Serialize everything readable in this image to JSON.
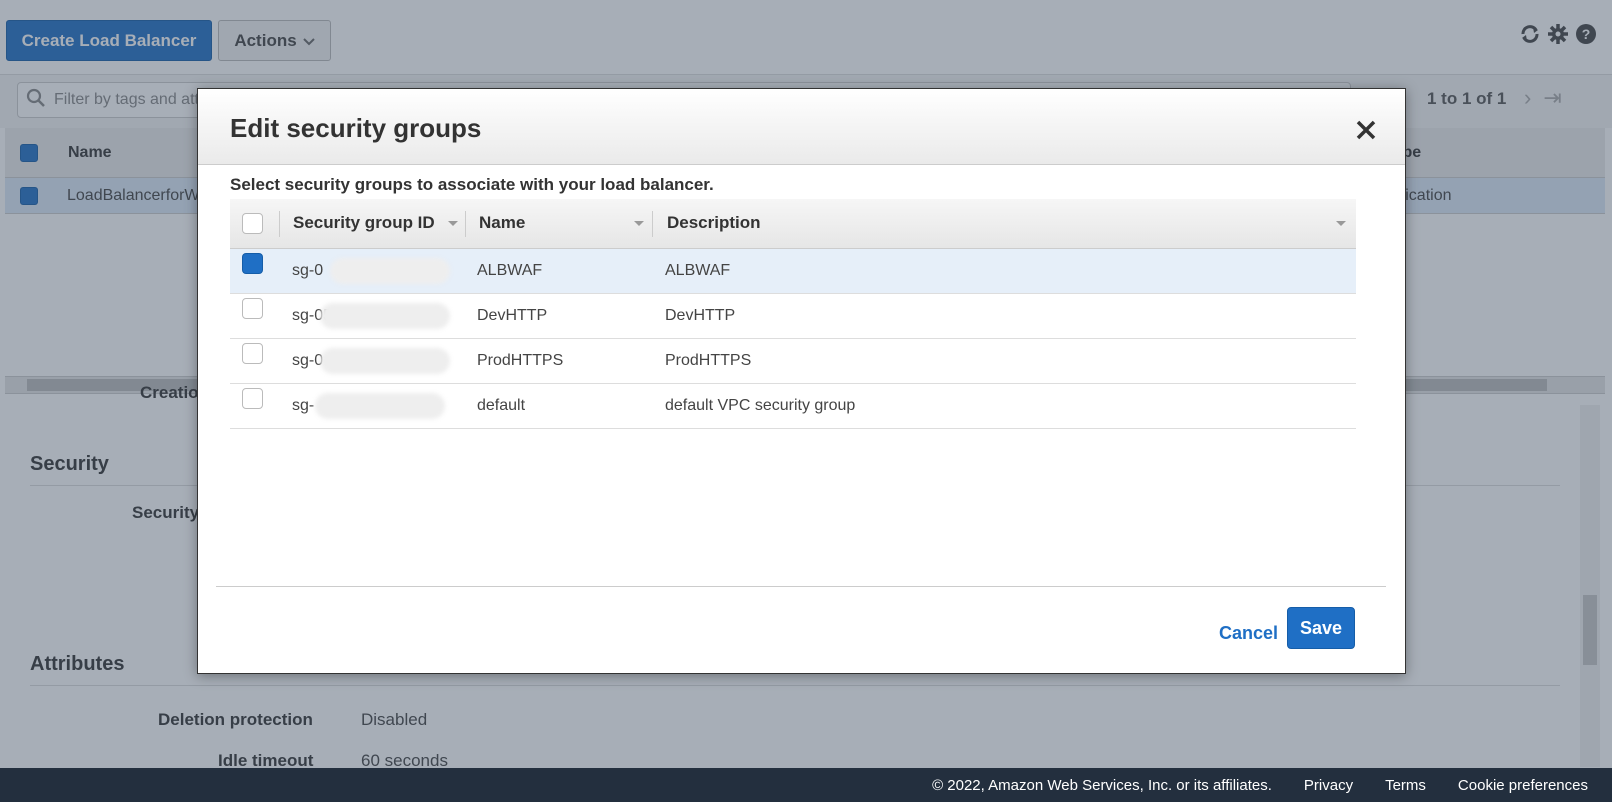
{
  "toolbar": {
    "create_label": "Create Load Balancer",
    "actions_label": "Actions"
  },
  "filter": {
    "placeholder": "Filter by tags and attributes or search by keyword",
    "pagination": "1 to 1 of 1"
  },
  "grid": {
    "columns": {
      "name": "Name",
      "type": "Type"
    },
    "row": {
      "name": "LoadBalancerforWAF",
      "type": "application"
    }
  },
  "details": {
    "cut_off_label": "Creation time",
    "security_section": "Security",
    "security_groups_label": "Security groups",
    "attributes_section": "Attributes",
    "deletion_protection_label": "Deletion protection",
    "deletion_protection_value": "Disabled",
    "idle_timeout_label": "Idle timeout",
    "idle_timeout_value": "60 seconds"
  },
  "modal": {
    "title": "Edit security groups",
    "subtitle": "Select security groups to associate with your load balancer.",
    "columns": {
      "id": "Security group ID",
      "name": "Name",
      "description": "Description"
    },
    "rows": [
      {
        "id_prefix": "sg-0",
        "name": "ALBWAF",
        "description": "ALBWAF",
        "checked": true
      },
      {
        "id_prefix": "sg-05",
        "name": "DevHTTP",
        "description": "DevHTTP",
        "checked": false
      },
      {
        "id_prefix": "sg-0",
        "name": "ProdHTTPS",
        "description": "ProdHTTPS",
        "checked": false
      },
      {
        "id_prefix": "sg-",
        "name": "default",
        "description": "default VPC security group",
        "checked": false
      }
    ],
    "cancel_label": "Cancel",
    "save_label": "Save"
  },
  "footer": {
    "copyright": "© 2022, Amazon Web Services, Inc. or its affiliates.",
    "privacy": "Privacy",
    "terms": "Terms",
    "cookies": "Cookie preferences"
  },
  "colors": {
    "accent": "#1f6fc5",
    "footer_bg": "#232f3e",
    "selected_row": "#e6eff9"
  },
  "icons": [
    "refresh-icon",
    "gear-icon",
    "help-icon",
    "search-icon",
    "close-icon",
    "chevron-down-icon"
  ]
}
